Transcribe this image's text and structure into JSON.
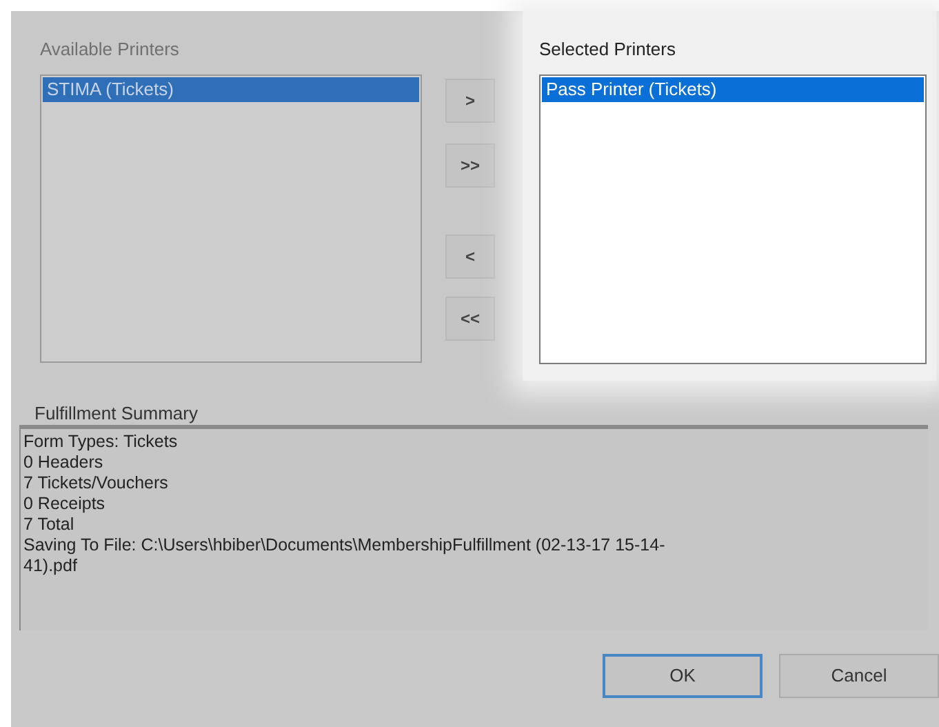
{
  "available_printers": {
    "label": "Available Printers",
    "items": [
      {
        "label": "STIMA (Tickets)",
        "selected": true
      }
    ]
  },
  "move_buttons": [
    ">",
    ">>",
    "<",
    "<<"
  ],
  "selected_printers": {
    "label": "Selected Printers",
    "items": [
      {
        "label": "Pass Printer (Tickets)",
        "selected": true
      }
    ]
  },
  "fulfillment_summary": {
    "label": "Fulfillment Summary",
    "lines": [
      "Form Types: Tickets",
      "0 Headers",
      "7 Tickets/Vouchers",
      "0 Receipts",
      "7 Total",
      "Saving To File: C:\\Users\\hbiber\\Documents\\MembershipFulfillment (02-13-17 15-14-",
      "41).pdf"
    ]
  },
  "buttons": [
    {
      "label": "OK",
      "default": true
    },
    {
      "label": "Cancel",
      "default": false
    }
  ]
}
